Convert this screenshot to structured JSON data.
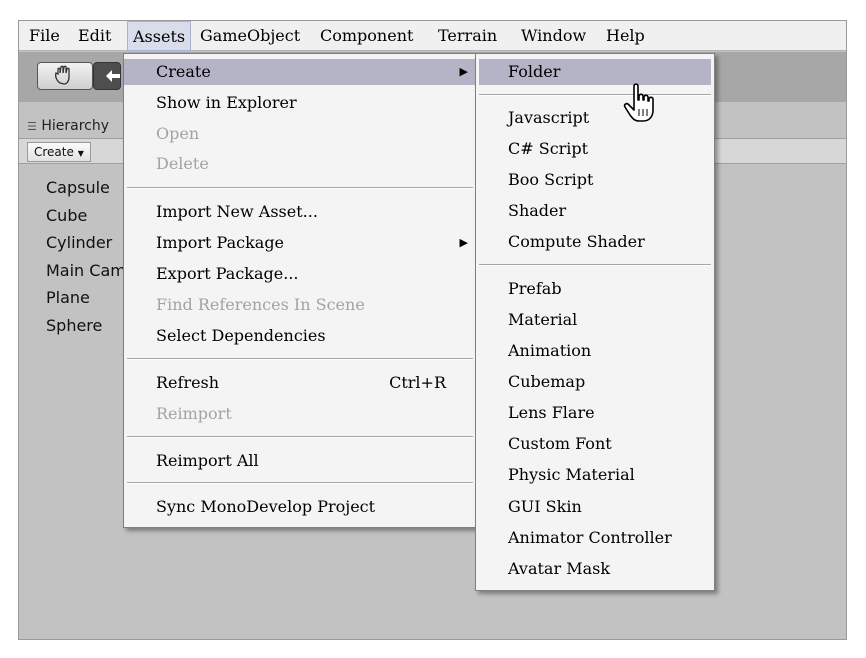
{
  "menubar": {
    "items": [
      {
        "label": "File"
      },
      {
        "label": "Edit"
      },
      {
        "label": "Assets"
      },
      {
        "label": "GameObject"
      },
      {
        "label": "Component"
      },
      {
        "label": "Terrain"
      },
      {
        "label": "Window"
      },
      {
        "label": "Help"
      }
    ],
    "active": "Assets"
  },
  "toolbar": {
    "hand_tool_icon": "hand-icon",
    "move_tool_icon": "move-arrows-icon"
  },
  "hierarchy": {
    "tab_label": "Hierarchy",
    "tab_icon": "list-icon",
    "create_button": "Create",
    "items": [
      "Capsule",
      "Cube",
      "Cylinder",
      "Main Camera",
      "Plane",
      "Sphere"
    ]
  },
  "assets_menu": {
    "items": [
      {
        "label": "Create",
        "has_submenu": true,
        "highlighted": true
      },
      {
        "label": "Show in Explorer"
      },
      {
        "label": "Open",
        "disabled": true
      },
      {
        "label": "Delete",
        "disabled": true
      },
      {
        "label": "Import New Asset..."
      },
      {
        "label": "Import Package",
        "has_submenu": true
      },
      {
        "label": "Export Package..."
      },
      {
        "label": "Find References In Scene",
        "disabled": true
      },
      {
        "label": "Select Dependencies"
      },
      {
        "label": "Refresh",
        "shortcut": "Ctrl+R"
      },
      {
        "label": "Reimport",
        "disabled": true
      },
      {
        "label": "Reimport All"
      },
      {
        "label": "Sync MonoDevelop Project"
      }
    ]
  },
  "create_menu": {
    "items": [
      {
        "label": "Folder",
        "highlighted": true
      },
      {
        "label": "Javascript"
      },
      {
        "label": "C# Script"
      },
      {
        "label": "Boo Script"
      },
      {
        "label": "Shader"
      },
      {
        "label": "Compute Shader"
      },
      {
        "label": "Prefab"
      },
      {
        "label": "Material"
      },
      {
        "label": "Animation"
      },
      {
        "label": "Cubemap"
      },
      {
        "label": "Lens Flare"
      },
      {
        "label": "Custom Font"
      },
      {
        "label": "Physic Material"
      },
      {
        "label": "GUI Skin"
      },
      {
        "label": "Animator Controller"
      },
      {
        "label": "Avatar Mask"
      }
    ]
  },
  "cursor": {
    "icon": "hand-pointer-cursor-icon"
  }
}
